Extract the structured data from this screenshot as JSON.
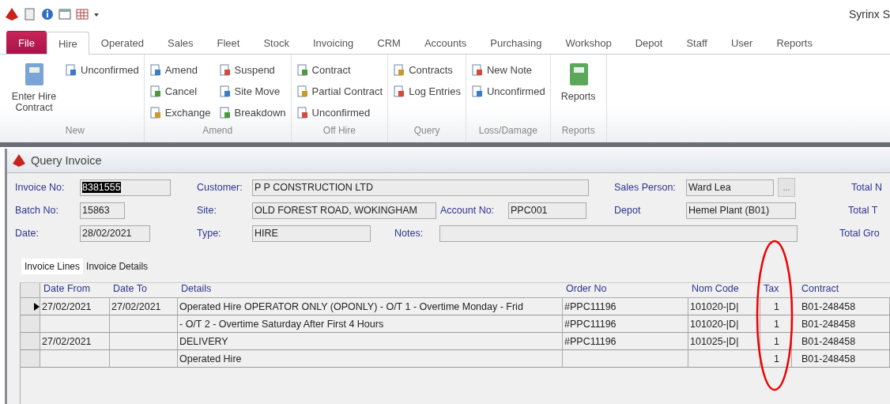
{
  "app_title": "Syrinx S",
  "tabs": [
    {
      "label": "File",
      "kind": "file",
      "selected": false
    },
    {
      "label": "Hire",
      "kind": "tab",
      "selected": true
    },
    {
      "label": "Operated",
      "kind": "tab",
      "selected": false
    },
    {
      "label": "Sales",
      "kind": "tab",
      "selected": false
    },
    {
      "label": "Fleet",
      "kind": "tab",
      "selected": false
    },
    {
      "label": "Stock",
      "kind": "tab",
      "selected": false
    },
    {
      "label": "Invoicing",
      "kind": "tab",
      "selected": false
    },
    {
      "label": "CRM",
      "kind": "tab",
      "selected": false
    },
    {
      "label": "Accounts",
      "kind": "tab",
      "selected": false
    },
    {
      "label": "Purchasing",
      "kind": "tab",
      "selected": false
    },
    {
      "label": "Workshop",
      "kind": "tab",
      "selected": false
    },
    {
      "label": "Depot",
      "kind": "tab",
      "selected": false
    },
    {
      "label": "Staff",
      "kind": "tab",
      "selected": false
    },
    {
      "label": "User",
      "kind": "tab",
      "selected": false
    },
    {
      "label": "Reports",
      "kind": "tab",
      "selected": false
    }
  ],
  "ribbon_groups": [
    {
      "label": "New",
      "items": [
        {
          "label": "Enter Hire Contract",
          "kind": "large"
        },
        {
          "label": "Unconfirmed",
          "kind": "small"
        }
      ]
    },
    {
      "label": "Amend",
      "items": [
        {
          "label": "Amend",
          "kind": "small"
        },
        {
          "label": "Cancel",
          "kind": "small"
        },
        {
          "label": "Exchange",
          "kind": "small"
        },
        {
          "label": "Suspend",
          "kind": "small"
        },
        {
          "label": "Site Move",
          "kind": "small"
        },
        {
          "label": "Breakdown",
          "kind": "small"
        }
      ]
    },
    {
      "label": "Off Hire",
      "items": [
        {
          "label": "Contract",
          "kind": "small"
        },
        {
          "label": "Partial Contract",
          "kind": "small"
        },
        {
          "label": "Unconfirmed",
          "kind": "small"
        }
      ]
    },
    {
      "label": "Query",
      "items": [
        {
          "label": "Contracts",
          "kind": "small"
        },
        {
          "label": "Log Entries",
          "kind": "small"
        }
      ]
    },
    {
      "label": "Loss/Damage",
      "items": [
        {
          "label": "New Note",
          "kind": "small"
        },
        {
          "label": "Unconfirmed",
          "kind": "small"
        }
      ]
    },
    {
      "label": "Reports",
      "items": [
        {
          "label": "Reports",
          "kind": "large"
        }
      ]
    }
  ],
  "window": {
    "title": "Query Invoice"
  },
  "form": {
    "invoice_no": {
      "label": "Invoice No:",
      "value": "8381555",
      "highlighted": true
    },
    "customer": {
      "label": "Customer:",
      "value": "P P CONSTRUCTION LTD"
    },
    "sales_person": {
      "label": "Sales Person:",
      "value": "Ward Lea",
      "button": "..."
    },
    "total_1": {
      "label": "Total N"
    },
    "batch_no": {
      "label": "Batch No:",
      "value": "15863"
    },
    "site": {
      "label": "Site:",
      "value": "OLD FOREST ROAD, WOKINGHAM"
    },
    "account_no": {
      "label": "Account No:",
      "value": "PPC001"
    },
    "depot": {
      "label": "Depot",
      "value": "Hemel Plant (B01)"
    },
    "total_2": {
      "label": "Total T"
    },
    "date": {
      "label": "Date:",
      "value": "28/02/2021"
    },
    "type": {
      "label": "Type:",
      "value": "HIRE"
    },
    "notes": {
      "label": "Notes:"
    },
    "total_3": {
      "label": "Total Gro"
    }
  },
  "sub_tabs": [
    {
      "label": "Invoice Lines",
      "selected": true
    },
    {
      "label": "Invoice Details",
      "selected": false
    }
  ],
  "grid": {
    "columns": [
      "Date From",
      "Date To",
      "Details",
      "Order No",
      "Nom Code",
      "Tax",
      "Contract"
    ],
    "rows": [
      {
        "current": true,
        "cells": [
          "27/02/2021",
          "27/02/2021",
          "Operated Hire  OPERATOR ONLY (OPONLY) - O/T 1 - Overtime Monday - Frid",
          "#PPC11196",
          "101020-|D|",
          "1",
          "B01-248458"
        ]
      },
      {
        "current": false,
        "cells": [
          null,
          null,
          " - O/T 2 - Overtime Saturday After First 4 Hours",
          "#PPC11196",
          "101020-|D|",
          "1",
          "B01-248458"
        ]
      },
      {
        "current": false,
        "cells": [
          "27/02/2021",
          null,
          "DELIVERY",
          "#PPC11196",
          "101025-|D|",
          "1",
          "B01-248458"
        ]
      },
      {
        "current": false,
        "cells": [
          null,
          null,
          "Operated Hire",
          null,
          null,
          "1",
          "B01-248458"
        ]
      }
    ]
  }
}
